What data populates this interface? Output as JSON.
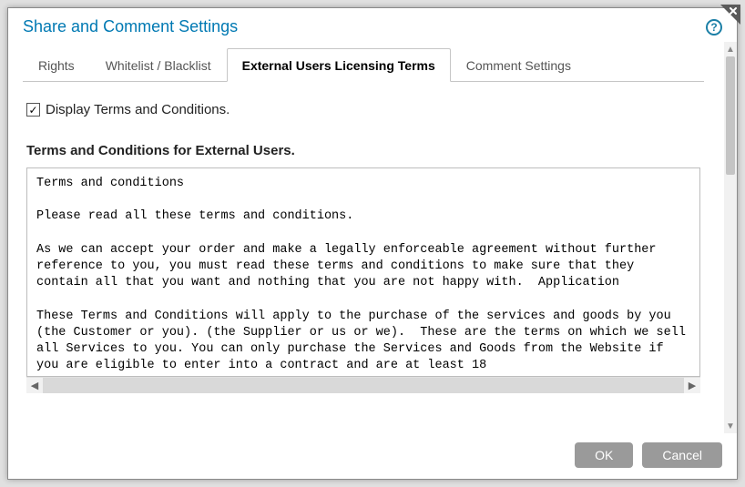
{
  "dialog": {
    "title": "Share and Comment Settings"
  },
  "tabs": {
    "items": [
      {
        "label": "Rights"
      },
      {
        "label": "Whitelist / Blacklist"
      },
      {
        "label": "External Users Licensing Terms"
      },
      {
        "label": "Comment Settings"
      }
    ],
    "active_index": 2
  },
  "checkbox": {
    "label": "Display Terms and Conditions.",
    "checked": true
  },
  "subheading": "Terms and Conditions for External Users.",
  "terms_text": "Terms and conditions\n\nPlease read all these terms and conditions.\n\nAs we can accept your order and make a legally enforceable agreement without further reference to you, you must read these terms and conditions to make sure that they contain all that you want and nothing that you are not happy with.  Application\n\nThese Terms and Conditions will apply to the purchase of the services and goods by you (the Customer or you). (the Supplier or us or we).  These are the terms on which we sell all Services to you. You can only purchase the Services and Goods from the Website if you are eligible to enter into a contract and are at least 18",
  "buttons": {
    "ok": "OK",
    "cancel": "Cancel"
  }
}
